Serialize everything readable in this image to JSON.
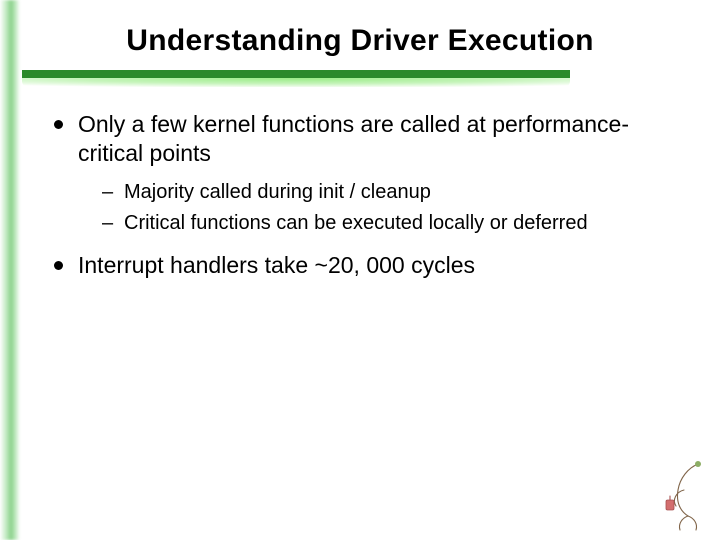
{
  "title": "Understanding Driver Execution",
  "bullets": [
    {
      "text": "Only a few kernel functions are called at performance-critical points",
      "sub": [
        "Majority called during init / cleanup",
        "Critical functions can be executed locally or deferred"
      ]
    },
    {
      "text": "Interrupt handlers take ~20, 000 cycles",
      "sub": []
    }
  ]
}
